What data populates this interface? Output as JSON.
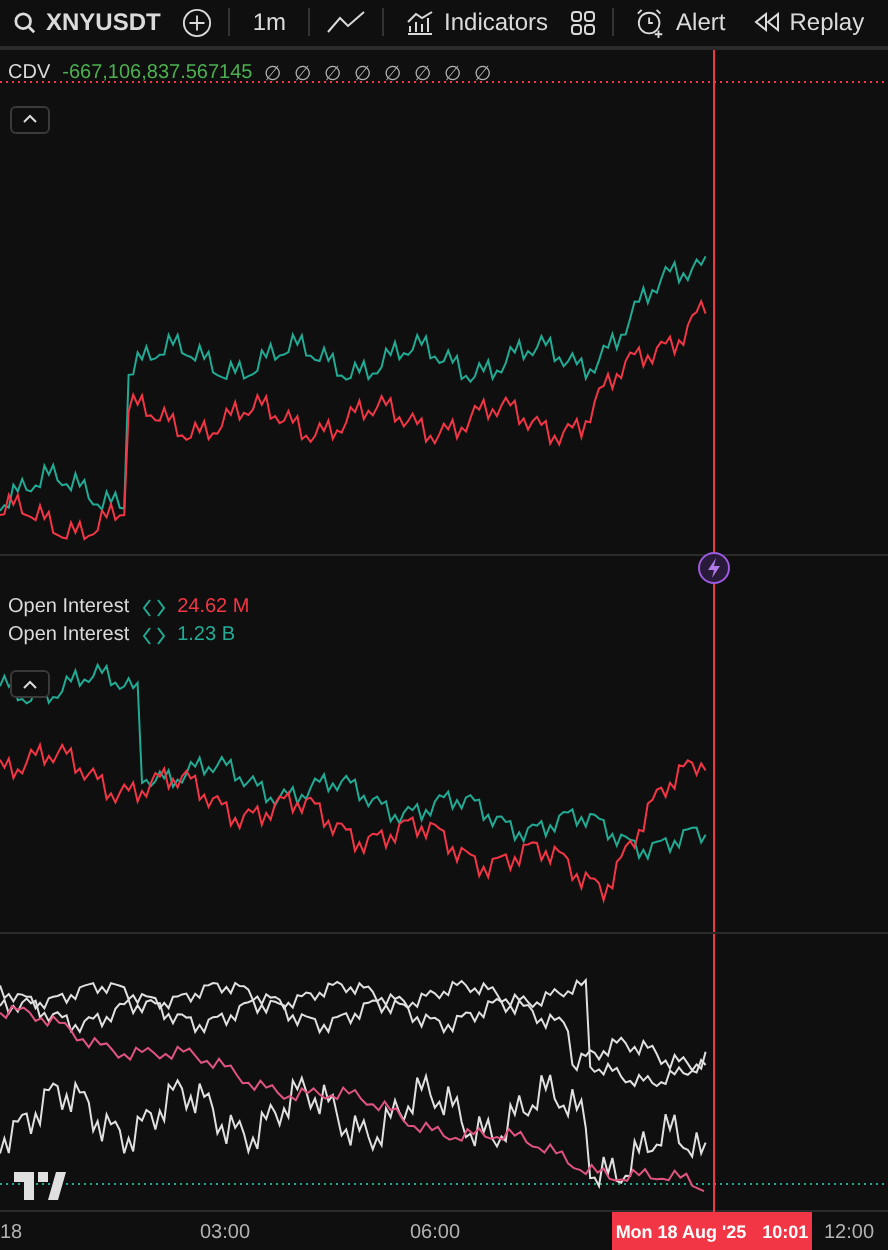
{
  "toolbar": {
    "symbol": "XNYUSDT",
    "interval": "1m",
    "indicators": "Indicators",
    "alert": "Alert",
    "replay": "Replay"
  },
  "cdv_pane": {
    "name": "CDV",
    "value": "-667,106,837.567145",
    "placeholders": [
      "∅",
      "∅",
      "∅",
      "∅",
      "∅",
      "∅",
      "∅",
      "∅"
    ]
  },
  "oi_pane": {
    "legends": [
      {
        "name": "Open Interest",
        "value": "24.62 M",
        "color": "#f23645"
      },
      {
        "name": "Open Interest",
        "value": "1.23 B",
        "color": "#22ab94"
      }
    ]
  },
  "time_axis": {
    "labels": [
      "18",
      "03:00",
      "06:00",
      "12:00"
    ],
    "crosshair_date": "Mon 18 Aug '25",
    "crosshair_time": "10:01"
  }
}
